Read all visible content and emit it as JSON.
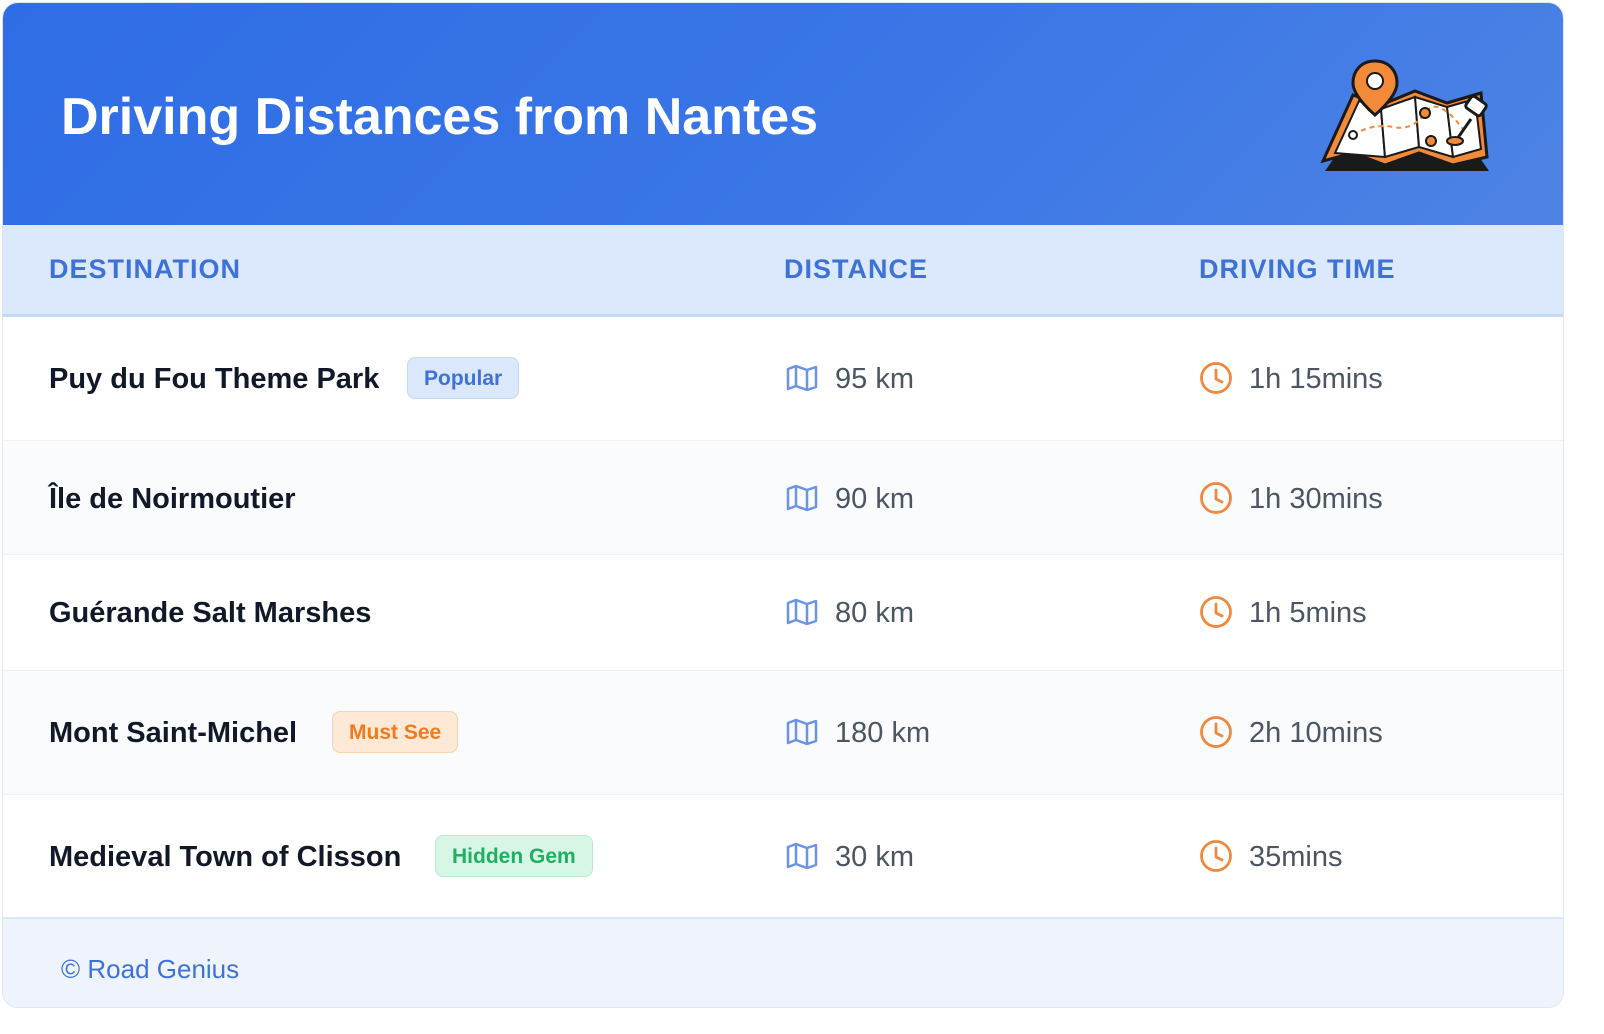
{
  "header": {
    "title": "Driving Distances from Nantes",
    "illustration_icon": "map-pin-illustration"
  },
  "columns": {
    "destination": "DESTINATION",
    "distance": "DISTANCE",
    "driving_time": "DRIVING TIME"
  },
  "rows": [
    {
      "destination": "Puy du Fou Theme Park",
      "badge": "Popular",
      "badge_color": "#3f72d6",
      "distance": "95 km",
      "time": "1h 15mins"
    },
    {
      "destination": "Île de Noirmoutier",
      "badge": "",
      "distance": "90 km",
      "time": "1h 30mins"
    },
    {
      "destination": "Guérande Salt Marshes",
      "badge": "",
      "distance": "80 km",
      "time": "1h 5mins"
    },
    {
      "destination": "Mont Saint-Michel",
      "badge": "Must See",
      "badge_color": "#f07a1e",
      "distance": "180 km",
      "time": "2h 10mins"
    },
    {
      "destination": "Medieval Town of Clisson",
      "badge": "Hidden Gem",
      "badge_color": "#1fb063",
      "distance": "30 km",
      "time": "35mins"
    }
  ],
  "icons": {
    "distance": "map-icon",
    "time": "clock-icon"
  },
  "colors": {
    "header_blue": "#2f6de6",
    "accent_orange": "#f0883e",
    "map_icon_blue": "#6b93e6"
  },
  "footer": {
    "copyright": "© Road Genius"
  }
}
